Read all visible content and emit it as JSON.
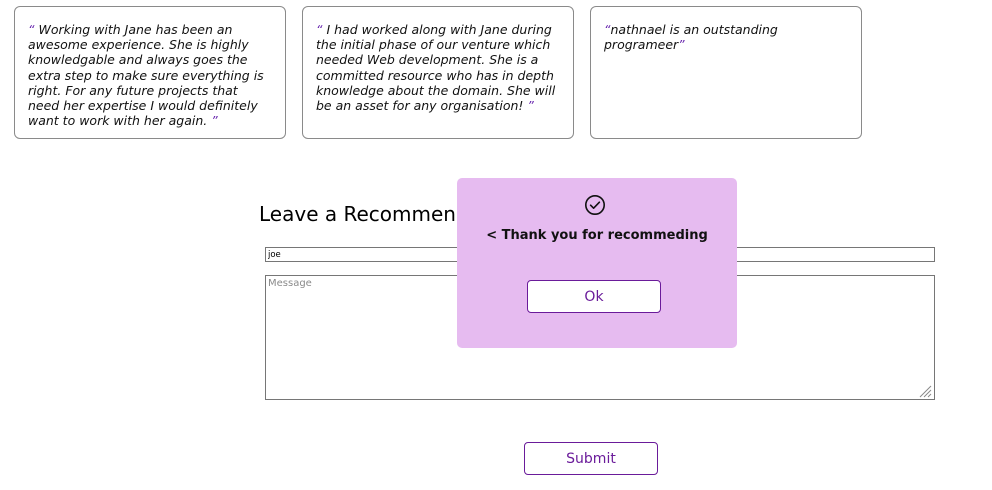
{
  "testimonials": [
    {
      "open_quote": "“",
      "text": " Working with Jane has been an awesome experience. She is highly knowledgable and always goes the extra step to make sure everything is right. For any future projects that need her expertise I would definitely want to work with her again. ",
      "close_quote": "”"
    },
    {
      "open_quote": "“",
      "text": " I had worked along with Jane during the initial phase of our venture which needed Web development. She is a committed resource who has in depth knowledge about the domain. She will be an asset for any organisation! ",
      "close_quote": "”"
    },
    {
      "open_quote": "“",
      "text": "nathnael is an outstanding programeer",
      "close_quote": "”"
    }
  ],
  "form": {
    "title": "Leave a Recommendation",
    "name_value": "joe",
    "message_placeholder": "Message",
    "submit_label": "Submit"
  },
  "dialog": {
    "icon": "check-circle-icon",
    "message": "< Thank you for recommeding",
    "ok_label": "Ok",
    "background": "#e6bbf0"
  },
  "colors": {
    "accent": "#6a1b9a"
  }
}
